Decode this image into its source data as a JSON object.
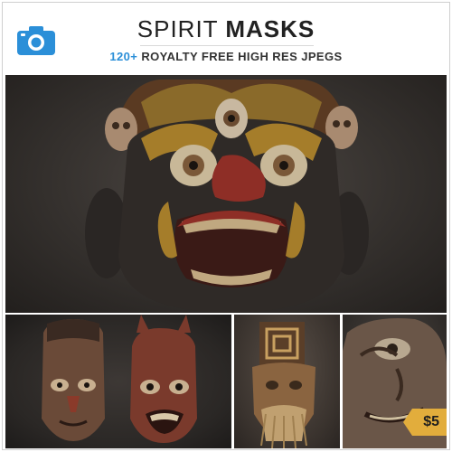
{
  "header": {
    "title_light": "SPIRIT",
    "title_bold": "MASKS",
    "subtitle_count": "120+",
    "subtitle_rest": "ROYALTY FREE HIGH RES JPEGS",
    "camera_icon": "camera-icon",
    "accent_color": "#2b8fd8"
  },
  "hero": {
    "subject": "mask-photo"
  },
  "thumbnails": [
    {
      "subject": "mask-photo"
    },
    {
      "subject": "mask-photo"
    },
    {
      "subject": "mask-photo"
    }
  ],
  "price_badge": {
    "label": "$5",
    "color": "#e2ad3c"
  }
}
